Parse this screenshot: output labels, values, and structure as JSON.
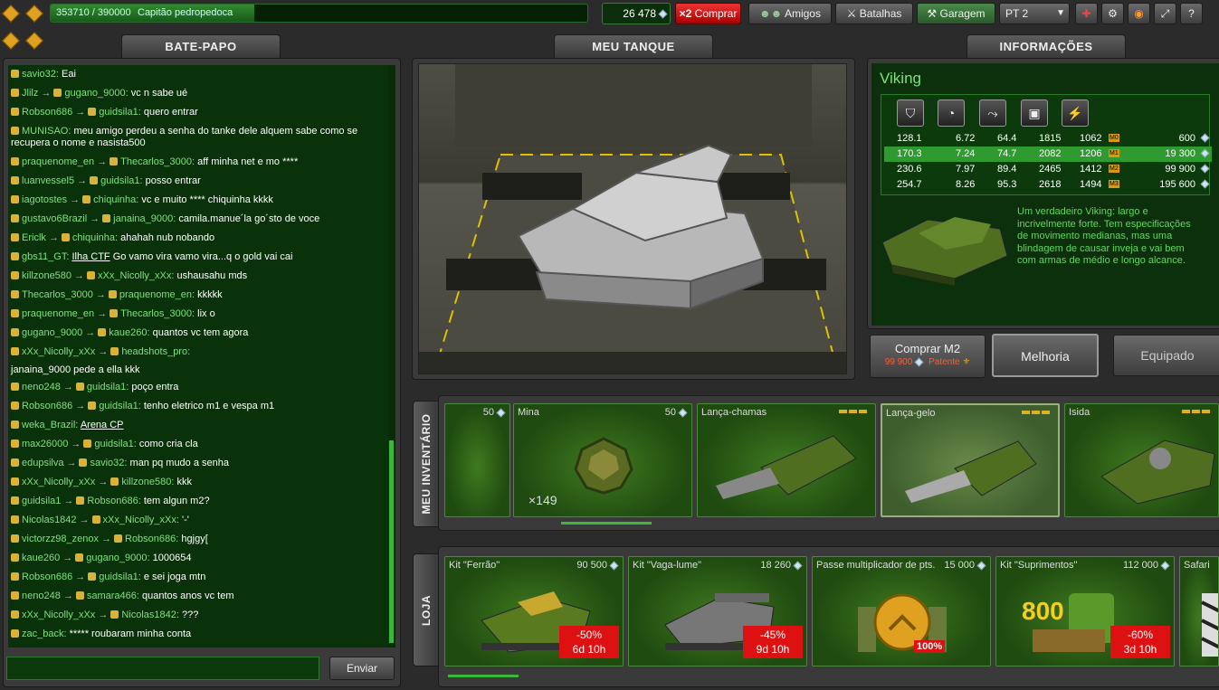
{
  "topbar": {
    "xp_text": "353710 / 390000",
    "rank_name": "Capitão pedropedoca",
    "crystals": "26 478",
    "buy_prefix": "×2",
    "buy_label": "Comprar",
    "friends_label": "Amigos",
    "battles_label": "Batalhas",
    "garage_label": "Garagem",
    "language": "PT 2"
  },
  "chat": {
    "title": "BATE-PAPO",
    "send_label": "Enviar",
    "input_value": "",
    "messages": [
      {
        "from": "savio32:",
        "to": "",
        "text": "Eai"
      },
      {
        "from": "Jlilz",
        "to": "gugano_9000:",
        "text": "vc n sabe ué"
      },
      {
        "from": "Robson686",
        "to": "guidsila1:",
        "text": "quero entrar"
      },
      {
        "from": "MUNISAO:",
        "to": "",
        "text": "meu amigo perdeu a senha do tanke dele alquem sabe como se recupera o nome e nasista500"
      },
      {
        "from": "praquenome_en",
        "to": "Thecarlos_3000:",
        "text": "aff minha net e mo ****"
      },
      {
        "from": "luanvessel5",
        "to": "guidsila1:",
        "text": "posso entrar"
      },
      {
        "from": "iagotostes",
        "to": "chiquinha:",
        "text": "vc e muito **** chiquinha kkkk"
      },
      {
        "from": "gustavo6Brazil",
        "to": "janaina_9000:",
        "text": "camila.manue´la go´sto de voce"
      },
      {
        "from": "Ericlk",
        "to": "chiquinha:",
        "text": "ahahah nub nobando"
      },
      {
        "from": "gbs11_GT:",
        "to": "",
        "link": "Ilha CTF",
        "text": "Go vamo vira vamo vira...q o gold vai cai"
      },
      {
        "from": "killzone580",
        "to": "xXx_Nicolly_xXx:",
        "text": "ushausahu mds"
      },
      {
        "from": "Thecarlos_3000",
        "to": "praquenome_en:",
        "text": "kkkkk"
      },
      {
        "from": "praquenome_en",
        "to": "Thecarlos_3000:",
        "text": "lix o"
      },
      {
        "from": "gugano_9000",
        "to": "kaue260:",
        "text": "quantos vc tem agora"
      },
      {
        "from": "xXx_Nicolly_xXx",
        "to": "headshots_pro:",
        "text": "",
        "extra": "janaina_9000 pede a ella kkk"
      },
      {
        "from": "neno248",
        "to": "guidsila1:",
        "text": "poço entra"
      },
      {
        "from": "Robson686",
        "to": "guidsila1:",
        "text": "tenho eletrico m1 e vespa m1"
      },
      {
        "from": "weka_Brazil:",
        "to": "",
        "link": "Arena CP",
        "text": ""
      },
      {
        "from": "max26000",
        "to": "guidsila1:",
        "text": "como cria cla"
      },
      {
        "from": "edupsilva",
        "to": "savio32:",
        "text": "man pq mudo a senha"
      },
      {
        "from": "xXx_Nicolly_xXx",
        "to": "killzone580:",
        "text": "kkk"
      },
      {
        "from": "guidsila1",
        "to": "Robson686:",
        "text": "tem algun m2?"
      },
      {
        "from": "Nicolas1842",
        "to": "xXx_Nicolly_xXx:",
        "text": "'-'"
      },
      {
        "from": "victorzz98_zenox",
        "to": "Robson686:",
        "text": "hgjgy["
      },
      {
        "from": "kaue260",
        "to": "gugano_9000:",
        "text": "1000654"
      },
      {
        "from": "Robson686",
        "to": "guidsila1:",
        "text": "e sei joga mtn"
      },
      {
        "from": "neno248",
        "to": "samara466:",
        "text": "quantos anos vc tem"
      },
      {
        "from": "xXx_Nicolly_xXx",
        "to": "Nicolas1842:",
        "text": "???"
      },
      {
        "from": "zac_back:",
        "to": "",
        "text": "***** roubaram minha conta"
      }
    ]
  },
  "tank": {
    "title": "MEU TANQUE"
  },
  "info": {
    "title": "INFORMAÇÕES",
    "name": "Viking",
    "stat_icons": [
      "armor-icon",
      "speed-icon",
      "turn-icon",
      "weight-icon",
      "power-icon"
    ],
    "rows": [
      {
        "v": [
          "128.1",
          "6.72",
          "64.4",
          "1815",
          "1062"
        ],
        "tag": "M0",
        "price": "600"
      },
      {
        "v": [
          "170.3",
          "7.24",
          "74.7",
          "2082",
          "1206"
        ],
        "tag": "M1",
        "price": "19 300"
      },
      {
        "v": [
          "230.6",
          "7.97",
          "89.4",
          "2465",
          "1412"
        ],
        "tag": "M2",
        "price": "99 900"
      },
      {
        "v": [
          "254.7",
          "8.26",
          "95.3",
          "2618",
          "1494"
        ],
        "tag": "M3",
        "price": "195 600"
      }
    ],
    "description": "Um verdadeiro Viking: largo e incrivelmente forte. Tem especificações de movimento medianas, mas uma blindagem de causar inveja e vai bem com armas de médio e longo alcance.",
    "buy_label": "Comprar M2",
    "buy_price": "99 900",
    "buy_rank": "Patente",
    "upgrade_label": "Melhoria",
    "equipped_label": "Equipado"
  },
  "inventory": {
    "title": "MEU INVENTÁRIO",
    "items": [
      {
        "name": "",
        "price": "50"
      },
      {
        "name": "Mina",
        "price": "50",
        "count": "×149"
      },
      {
        "name": "Lança-chamas",
        "price": ""
      },
      {
        "name": "Lança-gelo",
        "price": ""
      },
      {
        "name": "Isida",
        "price": ""
      }
    ]
  },
  "shop": {
    "title": "LOJA",
    "items": [
      {
        "name": "Kit \"Ferrão\"",
        "price": "90 500",
        "discount": "-50%",
        "time": "6d 10h"
      },
      {
        "name": "Kit \"Vaga-lume\"",
        "price": "18 260",
        "discount": "-45%",
        "time": "9d 10h"
      },
      {
        "name": "Passe multiplicador de pts.",
        "price": "15 000",
        "badge": "100%"
      },
      {
        "name": "Kit \"Suprimentos\"",
        "price": "112 000",
        "big": "800",
        "discount": "-60%",
        "time": "3d 10h"
      },
      {
        "name": "Safari",
        "price": ""
      }
    ]
  }
}
